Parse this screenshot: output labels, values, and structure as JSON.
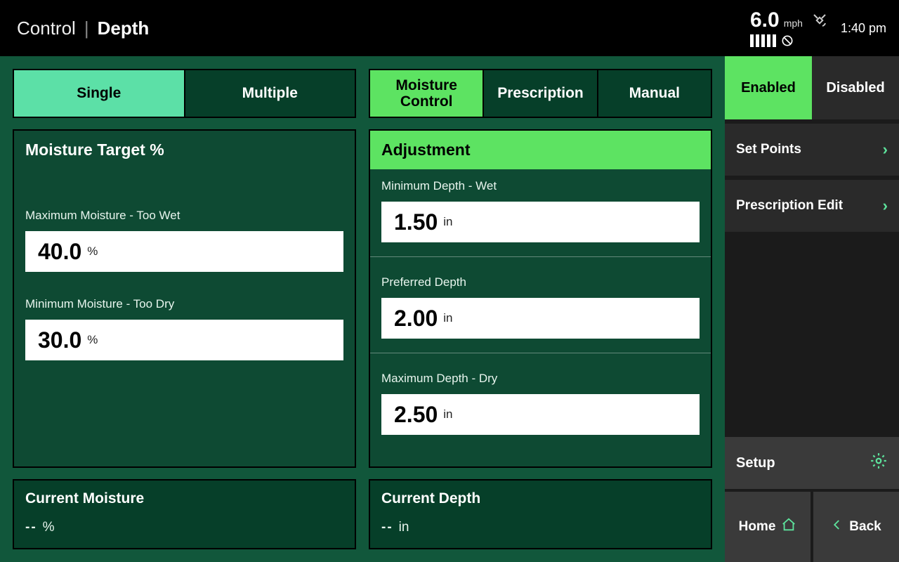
{
  "header": {
    "crumb1": "Control",
    "crumb2": "Depth",
    "speed_value": "6.0",
    "speed_unit": "mph",
    "time": "1:40 pm"
  },
  "tabs_left": {
    "single": "Single",
    "multiple": "Multiple"
  },
  "tabs_right": {
    "moisture_control": "Moisture Control",
    "prescription": "Prescription",
    "manual": "Manual"
  },
  "moisture_panel": {
    "title": "Moisture Target %",
    "max_label": "Maximum Moisture - Too Wet",
    "max_value": "40.0",
    "max_unit": "%",
    "min_label": "Minimum Moisture - Too Dry",
    "min_value": "30.0",
    "min_unit": "%"
  },
  "adjustment_panel": {
    "title": "Adjustment",
    "min_depth_label": "Minimum Depth - Wet",
    "min_depth_value": "1.50",
    "min_depth_unit": "in",
    "preferred_label": "Preferred Depth",
    "preferred_value": "2.00",
    "preferred_unit": "in",
    "max_depth_label": "Maximum Depth - Dry",
    "max_depth_value": "2.50",
    "max_depth_unit": "in"
  },
  "current_moisture": {
    "title": "Current Moisture",
    "value": "--",
    "unit": "%"
  },
  "current_depth": {
    "title": "Current Depth",
    "value": "--",
    "unit": "in"
  },
  "sidebar": {
    "enabled": "Enabled",
    "disabled": "Disabled",
    "set_points": "Set Points",
    "prescription_edit": "Prescription Edit",
    "setup": "Setup",
    "home": "Home",
    "back": "Back"
  }
}
